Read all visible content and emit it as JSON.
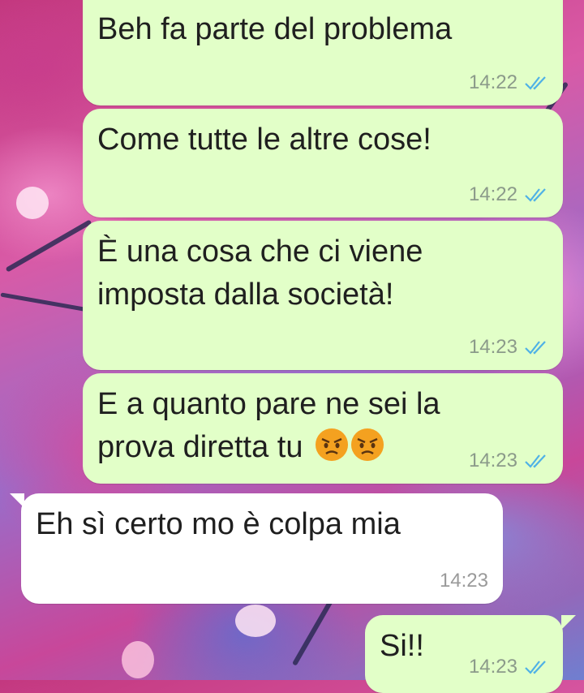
{
  "messages": [
    {
      "text": "Beh fa parte del problema",
      "time": "14:22",
      "direction": "outgoing",
      "status": "read"
    },
    {
      "text": "Come tutte le altre cose!",
      "time": "14:22",
      "direction": "outgoing",
      "status": "read"
    },
    {
      "line1": "È una cosa che ci viene",
      "line2": "imposta dalla società!",
      "time": "14:23",
      "direction": "outgoing",
      "status": "read"
    },
    {
      "line1": "E a quanto pare ne sei la",
      "line2": "prova diretta tu",
      "emoji": "pouting-face-icon x2",
      "time": "14:23",
      "direction": "outgoing",
      "status": "read"
    },
    {
      "text": "Eh sì certo mo è colpa mia",
      "time": "14:23",
      "direction": "incoming"
    },
    {
      "text": "Si!!",
      "time": "14:23",
      "direction": "outgoing",
      "status": "read"
    }
  ],
  "colors": {
    "outgoing_bubble": "#e2ffc8",
    "incoming_bubble": "#ffffff",
    "read_ticks": "#4fb1e6"
  }
}
